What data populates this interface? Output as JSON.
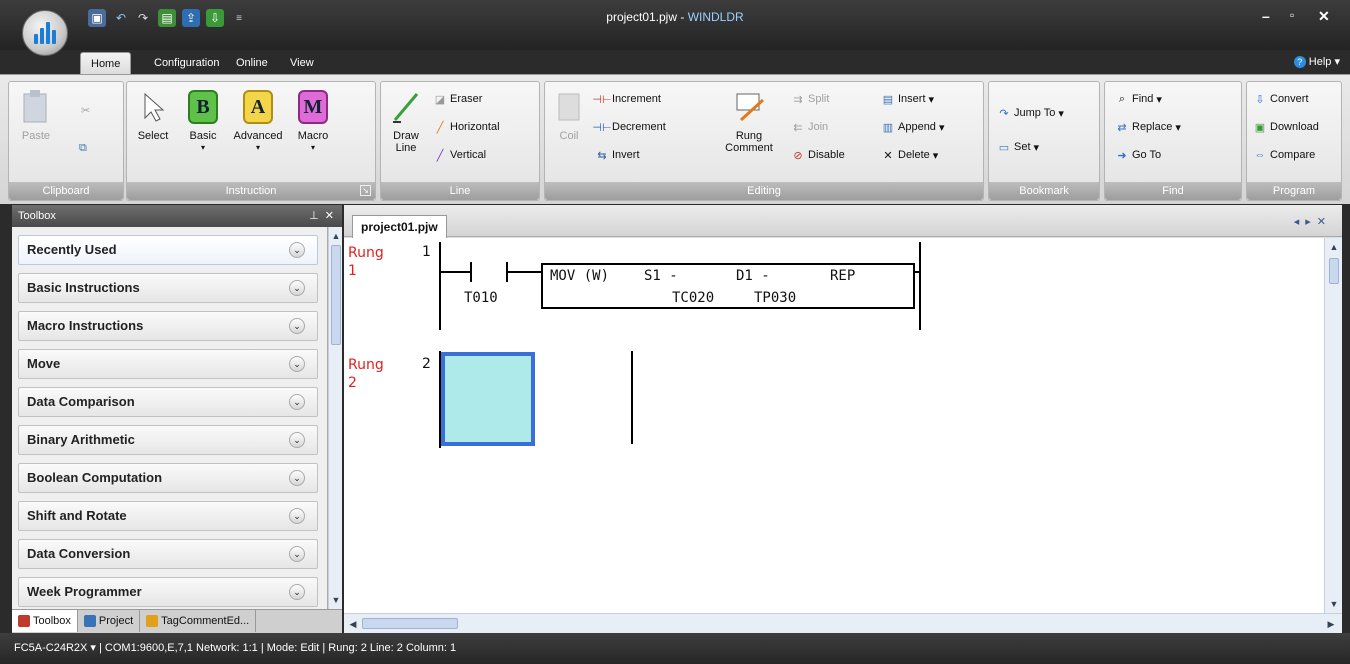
{
  "window": {
    "title_file": "project01.pjw",
    "title_sep": " - ",
    "title_app": "WINDLDR"
  },
  "ribbon_tabs": [
    "Home",
    "Configuration",
    "Online",
    "View"
  ],
  "help_label": "Help",
  "ribbon": {
    "clipboard": {
      "paste": "Paste",
      "footer": "Clipboard"
    },
    "instruction": {
      "select": "Select",
      "basic": "Basic",
      "advanced": "Advanced",
      "macro": "Macro",
      "footer": "Instruction",
      "basic_letter": "B",
      "advanced_letter": "A",
      "macro_letter": "M"
    },
    "line": {
      "draw_line": "Draw\nLine",
      "eraser": "Eraser",
      "horizontal": "Horizontal",
      "vertical": "Vertical",
      "footer": "Line"
    },
    "editing": {
      "coil": "Coil",
      "increment": "Increment",
      "decrement": "Decrement",
      "invert": "Invert",
      "rung_comment": "Rung\nComment",
      "split": "Split",
      "join": "Join",
      "disable": "Disable",
      "insert": "Insert",
      "append": "Append",
      "delete": "Delete",
      "footer": "Editing"
    },
    "bookmark": {
      "jump_to": "Jump To",
      "set": "Set",
      "footer": "Bookmark"
    },
    "find": {
      "find": "Find",
      "replace": "Replace",
      "go_to": "Go To",
      "footer": "Find"
    },
    "program": {
      "convert": "Convert",
      "download": "Download",
      "compare": "Compare",
      "footer": "Program"
    }
  },
  "toolbox": {
    "title": "Toolbox",
    "items": [
      "Recently Used",
      "Basic Instructions",
      "Macro Instructions",
      "Move",
      "Data Comparison",
      "Binary Arithmetic",
      "Boolean Computation",
      "Shift and Rotate",
      "Data Conversion",
      "Week Programmer"
    ],
    "bottom_tabs": [
      "Toolbox",
      "Project",
      "TagCommentEd..."
    ]
  },
  "document": {
    "tab": "project01.pjw",
    "rungs": [
      {
        "label": "Rung\n1",
        "number": "1",
        "contact": "T010",
        "instruction": "MOV (W)",
        "s1_label": "S1 -",
        "s1_value": "TC020",
        "d1_label": "D1 -",
        "d1_value": "TP030",
        "rep": "REP"
      },
      {
        "label": "Rung\n2",
        "number": "2"
      }
    ]
  },
  "status_bar": "FC5A-C24R2X  ▾  | COM1:9600,E,7,1  Network: 1:1 | Mode: Edit | Rung: 2  Line: 2  Column: 1",
  "colors": {
    "rung_label": "#e02020",
    "selection_fill": "#aeeaea",
    "selection_border": "#3a6fd8",
    "app_title": "#9ad0ff"
  }
}
